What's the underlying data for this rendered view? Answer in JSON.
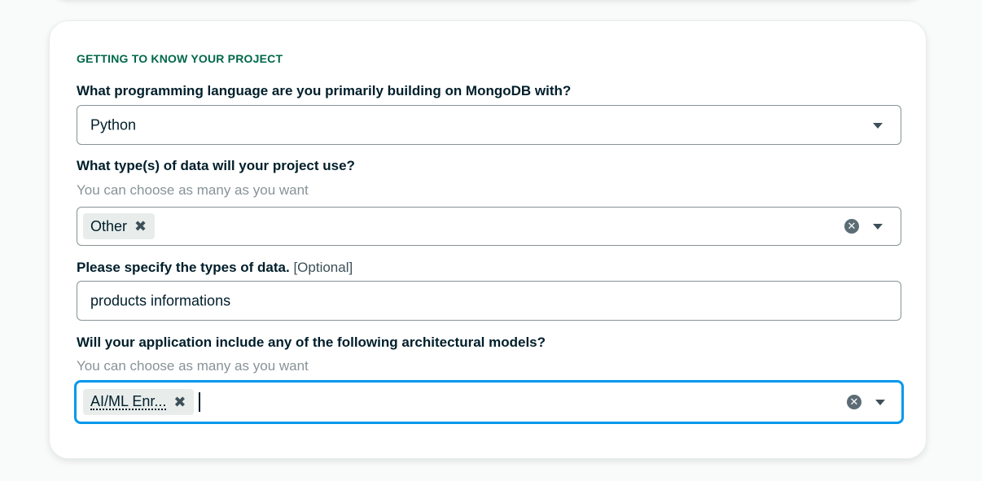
{
  "section": {
    "title": "GETTING TO KNOW YOUR PROJECT"
  },
  "q_language": {
    "label": "What programming language are you primarily building on MongoDB with?",
    "value": "Python"
  },
  "q_data_types": {
    "label": "What type(s) of data will your project use?",
    "hint": "You can choose as many as you want",
    "chips": [
      "Other"
    ],
    "clear_icon": "clear-circle-icon",
    "chip_remove_icon": "close-icon"
  },
  "q_specify": {
    "label": "Please specify the types of data.",
    "optional": "[Optional]",
    "value": "products informations"
  },
  "q_arch": {
    "label": "Will your application include any of the following architectural models?",
    "hint": "You can choose as many as you want",
    "chips": [
      "AI/ML Enr..."
    ],
    "focused": true
  },
  "colors": {
    "section_title": "#00684a",
    "focus_border": "#0498ec",
    "text": "#001e2b",
    "hint": "#889397"
  }
}
